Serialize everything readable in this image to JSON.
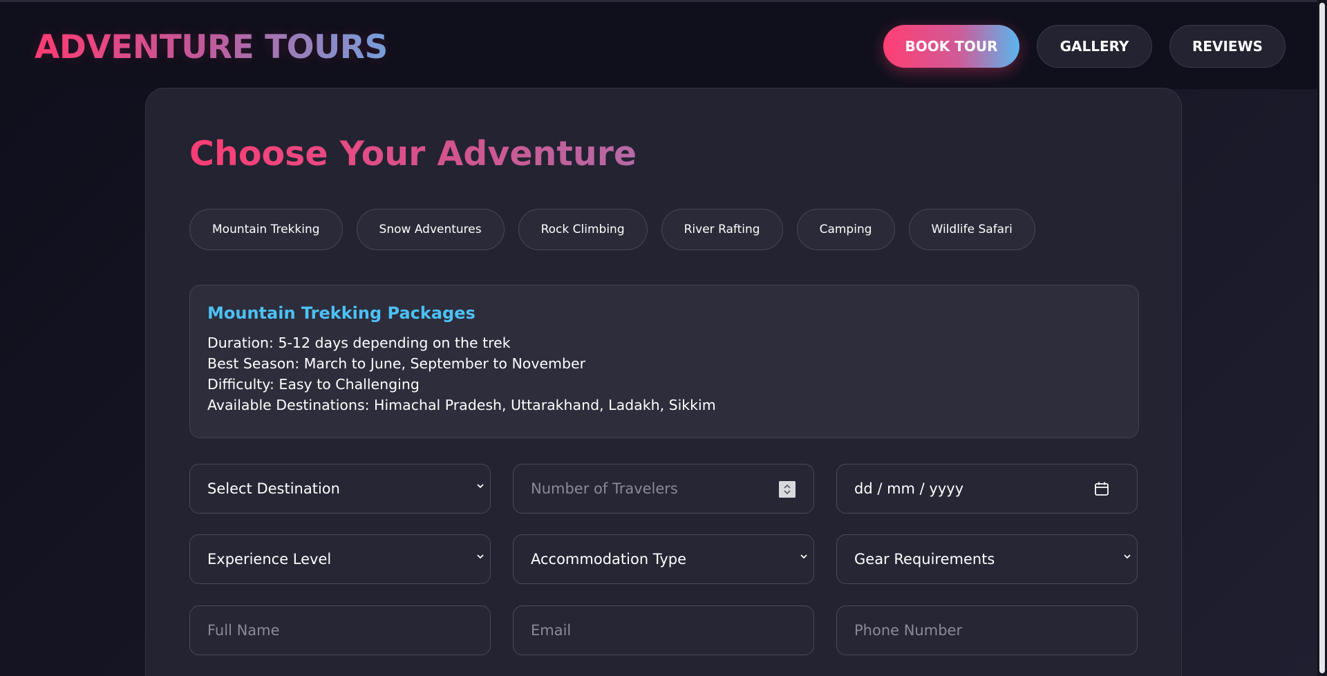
{
  "header": {
    "logo": "ADVENTURE TOURS",
    "nav": {
      "book_tour": "BOOK TOUR",
      "gallery": "GALLERY",
      "reviews": "REVIEWS"
    }
  },
  "main": {
    "title": "Choose Your Adventure",
    "categories": [
      "Mountain Trekking",
      "Snow Adventures",
      "Rock Climbing",
      "River Rafting",
      "Camping",
      "Wildlife Safari"
    ],
    "info": {
      "title": "Mountain Trekking Packages",
      "lines": [
        "Duration: 5-12 days depending on the trek",
        "Best Season: March to June, September to November",
        "Difficulty: Easy to Challenging",
        "Available Destinations: Himachal Pradesh, Uttarakhand, Ladakh, Sikkim"
      ]
    },
    "form": {
      "destination": "Select Destination",
      "travelers_placeholder": "Number of Travelers",
      "date_placeholder": "dd / mm / yyyy",
      "experience": "Experience Level",
      "accommodation": "Accommodation Type",
      "gear": "Gear Requirements",
      "name_placeholder": "Full Name",
      "email_placeholder": "Email",
      "phone_placeholder": "Phone Number"
    }
  },
  "colors": {
    "accent_pink": "#ff3d74",
    "accent_blue": "#4cc1f5",
    "card_bg": "#232331"
  },
  "icons": {
    "select": "chevron-down-icon",
    "number": "stepper-icon",
    "date": "calendar-icon"
  }
}
